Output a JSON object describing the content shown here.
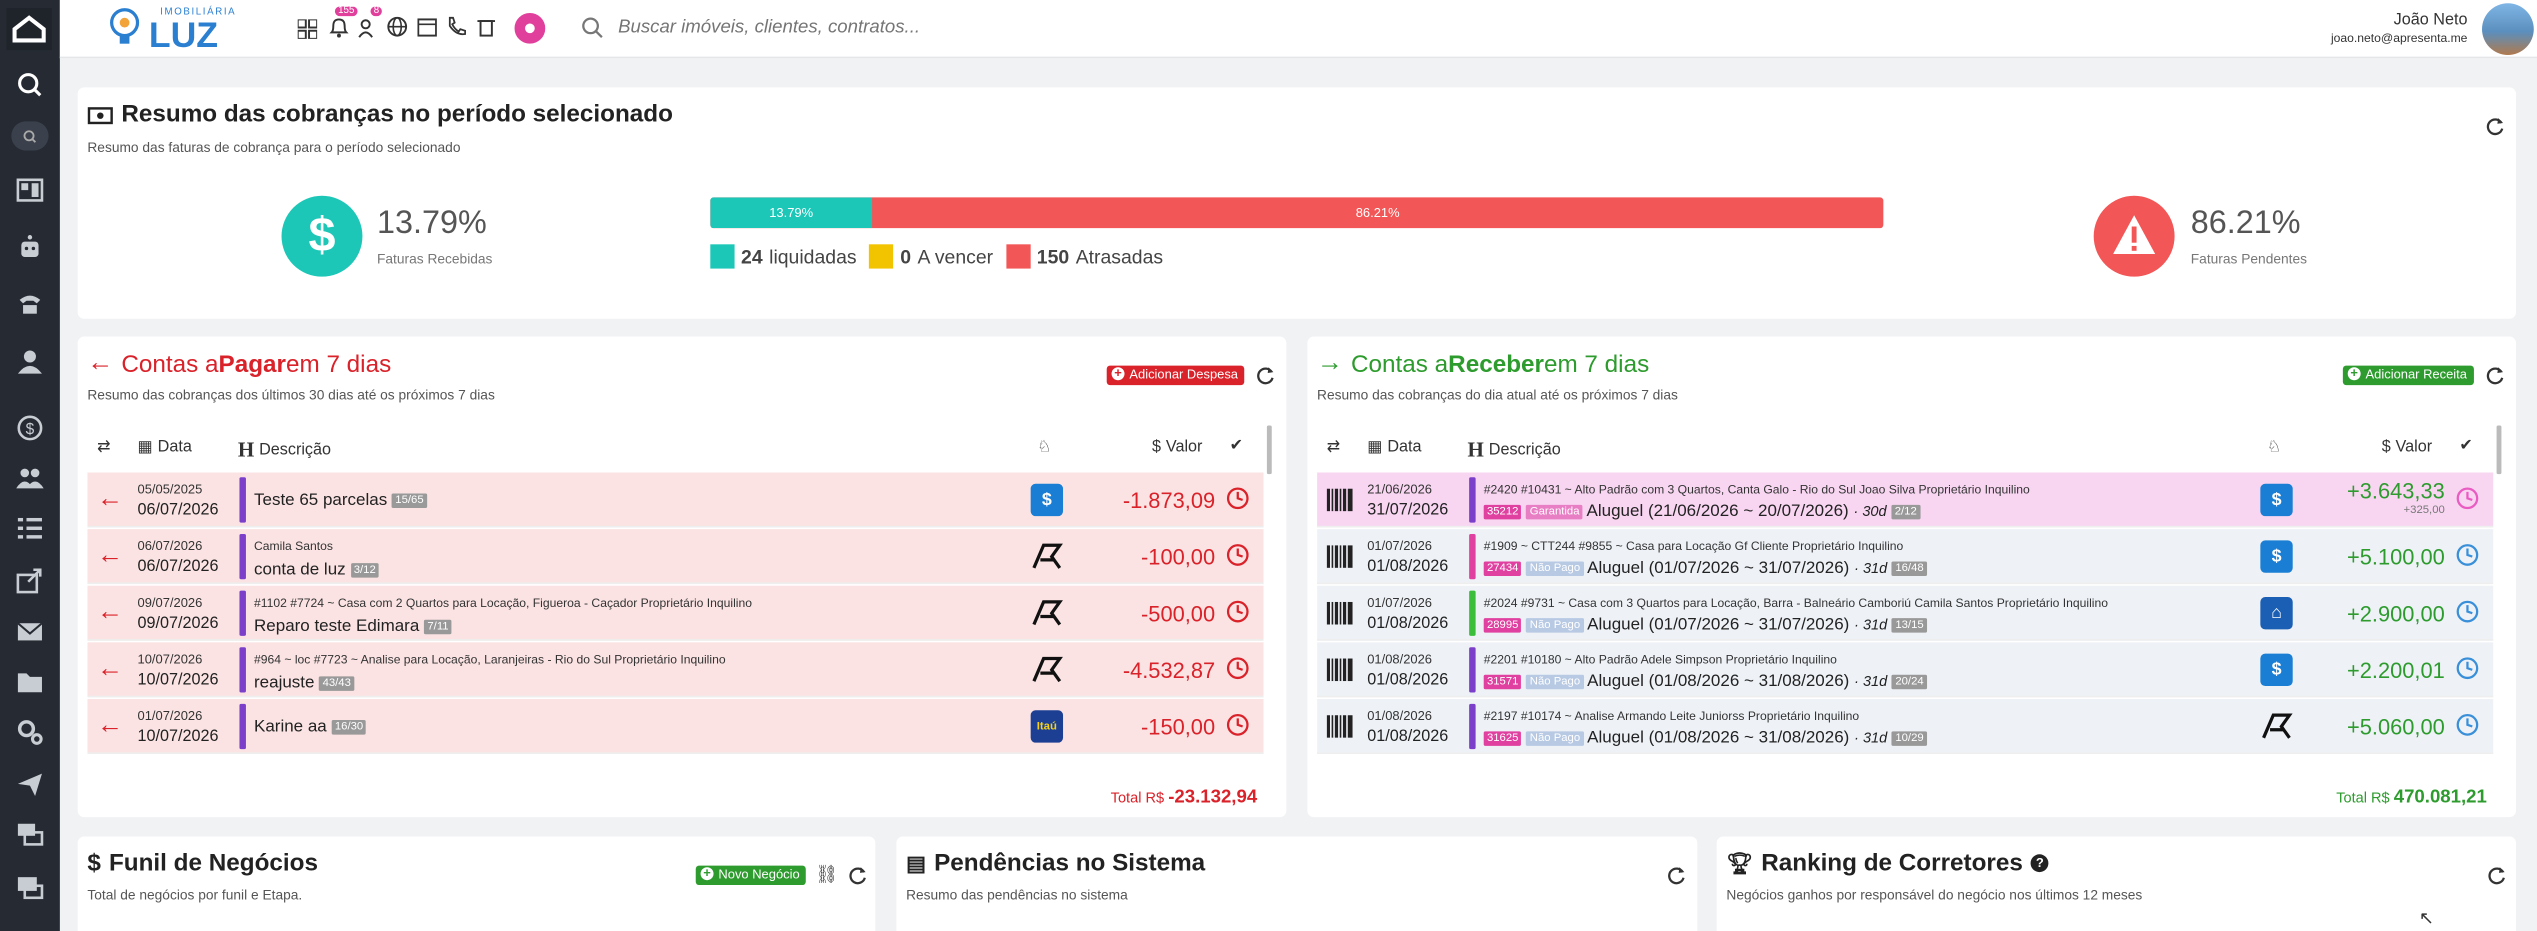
{
  "brand": {
    "top": "IMOBILIÁRIA",
    "name": "LUZ"
  },
  "topbar": {
    "badge_bell": "155",
    "badge_users": "8",
    "search_placeholder": "Buscar imóveis, clientes, contratos...",
    "user_name": "João Neto",
    "user_email": "joao.neto@apresenta.me"
  },
  "summary": {
    "title": "Resumo das cobranças no período selecionado",
    "subtitle": "Resumo das faturas de cobrança para o período selecionado",
    "received_pct": "13.79%",
    "received_label": "Faturas Recebidas",
    "pending_pct": "86.21%",
    "pending_label": "Faturas Pendentes",
    "bar_left": "13.79%",
    "bar_right": "86.21%",
    "received_fraction": 0.1379,
    "legend": [
      {
        "count": "24",
        "label": "liquidadas",
        "color": "#1cc7b8"
      },
      {
        "count": "0",
        "label": "A vencer",
        "color": "#f2c400"
      },
      {
        "count": "150",
        "label": "Atrasadas",
        "color": "#f25656"
      }
    ]
  },
  "pay": {
    "title_pre": "Contas a ",
    "title_mid": "Pagar",
    "title_post": " em 7 dias",
    "subtitle": "Resumo das cobranças dos últimos 30 dias até os próximos 7 dias",
    "add_label": "Adicionar Despesa",
    "col_date": "Data",
    "col_desc": "Descrição",
    "col_value": "Valor",
    "total_label": "Total R$",
    "total": "-23.132,94",
    "rows": [
      {
        "d1": "05/05/2025",
        "d2": "06/07/2026",
        "meta": "",
        "desc": "Teste 65 parcelas",
        "badge": "15/65",
        "value": "-1.873,09",
        "icon": "money-bag-icon"
      },
      {
        "d1": "06/07/2026",
        "d2": "06/07/2026",
        "meta": "Camila Santos",
        "desc": "conta de luz",
        "badge": "3/12",
        "value": "-100,00",
        "icon": "rr-logo-icon"
      },
      {
        "d1": "09/07/2026",
        "d2": "09/07/2026",
        "meta": "#1102  #7724 ~ Casa com 2 Quartos para Locação, Figueroa - Caçador  Proprietário  Inquilino",
        "desc": "Reparo teste Edimara",
        "badge": "7/11",
        "value": "-500,00",
        "icon": "rr-logo-icon"
      },
      {
        "d1": "10/07/2026",
        "d2": "10/07/2026",
        "meta": "#964 ~ loc  #7723 ~ Analise para Locação, Laranjeiras - Rio do Sul  Proprietário  Inquilino",
        "desc": "reajuste",
        "badge": "43/43",
        "value": "-4.532,87",
        "icon": "rr-logo-icon"
      },
      {
        "d1": "01/07/2026",
        "d2": "10/07/2026",
        "meta": "",
        "desc": "Karine aa",
        "badge": "16/30",
        "value": "-150,00",
        "icon": "itau-icon"
      }
    ]
  },
  "receive": {
    "title_pre": "Contas a ",
    "title_mid": "Receber",
    "title_post": " em 7 dias",
    "subtitle": "Resumo das cobranças do dia atual até os próximos 7 dias",
    "add_label": "Adicionar Receita",
    "col_date": "Data",
    "col_desc": "Descrição",
    "col_value": "Valor",
    "total_label": "Total R$",
    "total": "470.081,21",
    "rows": [
      {
        "d1": "21/06/2026",
        "d2": "31/07/2026",
        "meta": "#2420  #10431 ~ Alto Padrão com 3 Quartos, Canta Galo - Rio do Sul  Joao Silva  Proprietário  Inquilino",
        "id": "35212",
        "tag": "Garantida",
        "desc": "Aluguel (21/06/2026 ~ 20/07/2026)",
        "days": "· 30d",
        "badge": "2/12",
        "value": "+3.643,33",
        "extra": "+325,00",
        "bar": "#7b3fc9",
        "bg": "#f8d6f2"
      },
      {
        "d1": "01/07/2026",
        "d2": "01/08/2026",
        "meta": "#1909 ~ CTT244  #9855 ~ Casa para Locação  Gf Cliente  Proprietário  Inquilino",
        "id": "27434",
        "tag": "Não Pago",
        "desc": "Aluguel (01/07/2026 ~ 31/07/2026)",
        "days": "· 31d",
        "badge": "16/48",
        "value": "+5.100,00",
        "extra": "",
        "bar": "#e040a0",
        "bg": "#eef2f7"
      },
      {
        "d1": "01/07/2026",
        "d2": "01/08/2026",
        "meta": "#2024  #9731 ~ Casa com 3 Quartos para Locação, Barra - Balneário Camboriú  Camila Santos  Proprietário  Inquilino",
        "id": "28995",
        "tag": "Não Pago",
        "desc": "Aluguel (01/07/2026 ~ 31/07/2026)",
        "days": "· 31d",
        "badge": "13/15",
        "value": "+2.900,00",
        "extra": "",
        "bar": "#3bbf3b",
        "bg": "#eef2f7"
      },
      {
        "d1": "01/08/2026",
        "d2": "01/08/2026",
        "meta": "#2201  #10180 ~ Alto Padrão  Adele Simpson  Proprietário  Inquilino",
        "id": "31571",
        "tag": "Não Pago",
        "desc": "Aluguel (01/08/2026 ~ 31/08/2026)",
        "days": "· 31d",
        "badge": "20/24",
        "value": "+2.200,01",
        "extra": "",
        "bar": "#7b3fc9",
        "bg": "#eef2f7"
      },
      {
        "d1": "01/08/2026",
        "d2": "01/08/2026",
        "meta": "#2197  #10174 ~ Analise  Armando Leite Juniorss  Proprietário  Inquilino",
        "id": "31625",
        "tag": "Não Pago",
        "desc": "Aluguel (01/08/2026 ~ 31/08/2026)",
        "days": "· 31d",
        "badge": "10/29",
        "value": "+5.060,00",
        "extra": "",
        "bar": "#7b3fc9",
        "bg": "#eef2f7"
      }
    ]
  },
  "funnel": {
    "title": "Funil de Negócios",
    "subtitle": "Total de negócios por funil e Etapa.",
    "add_label": "Novo Negócio"
  },
  "pend": {
    "title": "Pendências no Sistema",
    "subtitle": "Resumo das pendências no sistema"
  },
  "ranking": {
    "title": "Ranking de Corretores",
    "subtitle": "Negócios ganhos por responsável do negócio nos últimos 12 meses"
  }
}
